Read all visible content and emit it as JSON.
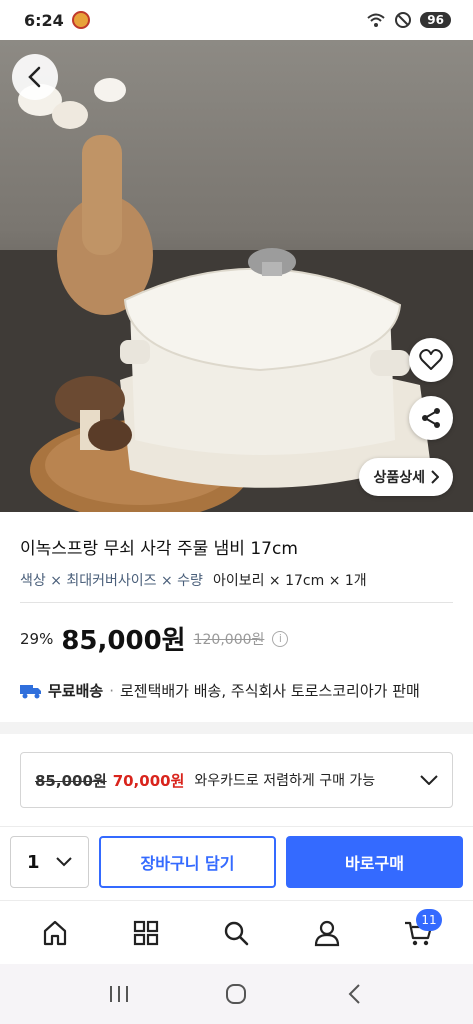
{
  "status_bar": {
    "time": "6:24",
    "battery": "96"
  },
  "hero": {
    "detail_button_label": "상품상세"
  },
  "product": {
    "name": "이녹스프랑 무쇠 사각 주물 냄비 17cm",
    "option_label": "색상 × 최대커버사이즈 × 수량",
    "option_value": "아이보리 × 17cm × 1개",
    "discount": "29%",
    "price": "85,000원",
    "original_price": "120,000원",
    "shipping_free": "무료배송",
    "shipping_detail": "로젠택배가 배송, 주식회사 토로스코리아가 판매"
  },
  "card_offer": {
    "original": "85,000원",
    "discounted": "70,000원",
    "text": "와우카드로 저렴하게 구매 가능"
  },
  "purchase": {
    "quantity": "1",
    "cart_label": "장바구니 담기",
    "buy_label": "바로구매"
  },
  "tabbar": {
    "cart_count": "11"
  },
  "colors": {
    "accent": "#346aff",
    "sale_red": "#d9241c"
  }
}
